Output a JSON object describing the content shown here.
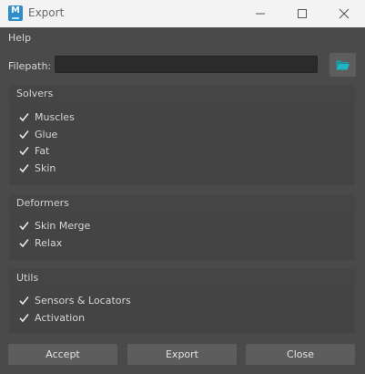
{
  "window": {
    "title": "Export",
    "app_icon_letter": "M"
  },
  "menu": {
    "help": "Help"
  },
  "filepath": {
    "label": "Filepath:",
    "value": "",
    "placeholder": ""
  },
  "groups": {
    "solvers": {
      "title": "Solvers",
      "items": [
        {
          "label": "Muscles",
          "checked": true
        },
        {
          "label": "Glue",
          "checked": true
        },
        {
          "label": "Fat",
          "checked": true
        },
        {
          "label": "Skin",
          "checked": true
        }
      ]
    },
    "deformers": {
      "title": "Deformers",
      "items": [
        {
          "label": "Skin Merge",
          "checked": true
        },
        {
          "label": "Relax",
          "checked": true
        }
      ]
    },
    "utils": {
      "title": "Utils",
      "items": [
        {
          "label": "Sensors & Locators",
          "checked": true
        },
        {
          "label": "Activation",
          "checked": true
        }
      ]
    }
  },
  "buttons": {
    "accept": "Accept",
    "export": "Export",
    "close": "Close"
  },
  "colors": {
    "background": "#4a4a4a",
    "titlebar": "#f3f3f3",
    "folder_icon": "#1fb5c4",
    "button": "#5d5d5d"
  }
}
